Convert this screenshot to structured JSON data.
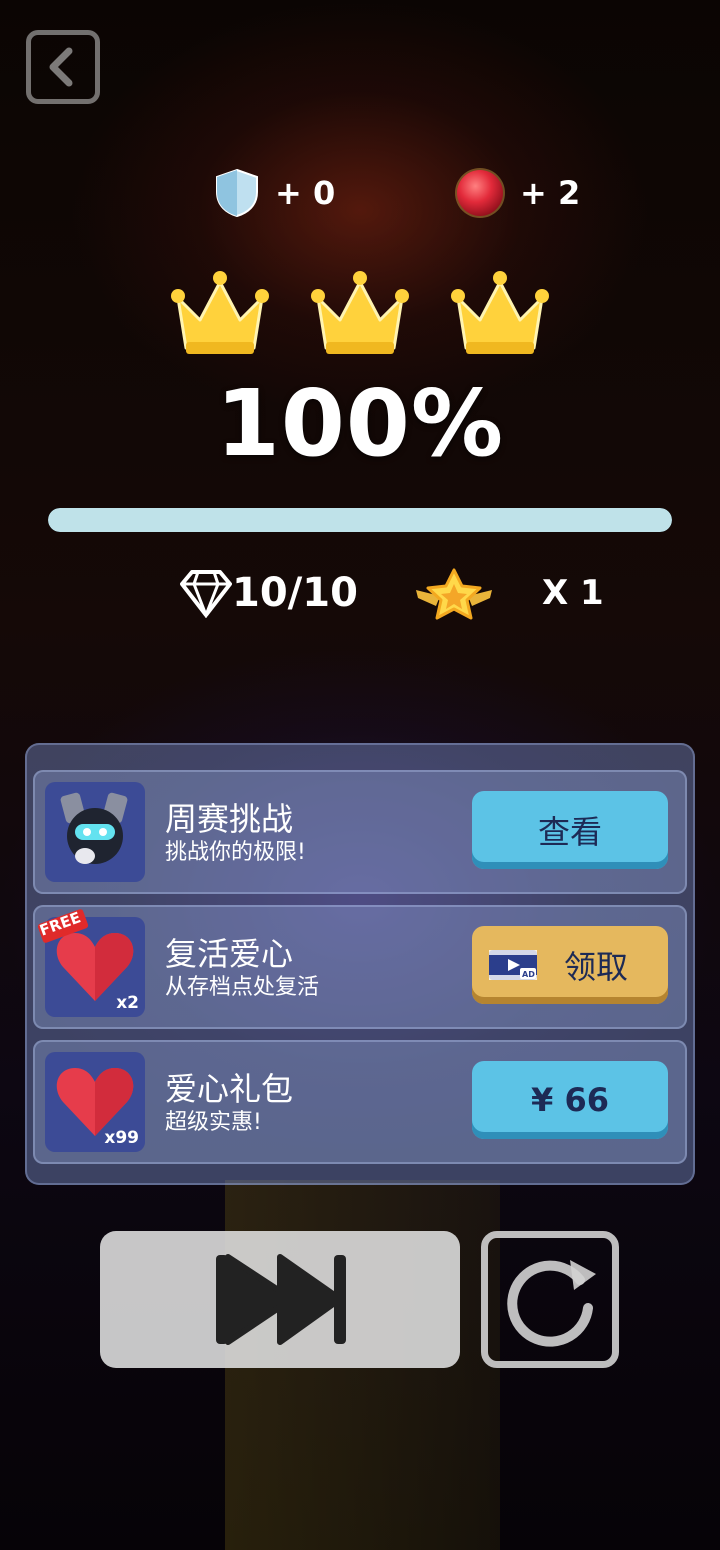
{
  "rewards": {
    "shield_bonus": "+ 0",
    "ball_bonus": "+ 2"
  },
  "crowns": {
    "earned": 3,
    "total": 3
  },
  "progress": {
    "percent_label": "100%",
    "fill_fraction": 1.0
  },
  "stats": {
    "diamonds": "10/10",
    "multiplier": "X 1"
  },
  "offers": [
    {
      "title": "周赛挑战",
      "subtitle": "挑战你的极限!",
      "button_label": "查看",
      "icon": "robot-character-icon"
    },
    {
      "title": "复活爱心",
      "subtitle": "从存档点处复活",
      "button_label": "领取",
      "badge": "FREE",
      "count": "x2",
      "icon": "heart-icon",
      "button_icon": "video-ad-icon"
    },
    {
      "title": "爱心礼包",
      "subtitle": "超级实惠!",
      "button_label": "¥ 66",
      "count": "x99",
      "icon": "heart-icon"
    }
  ],
  "controls": {
    "back": "back-arrow-icon",
    "skip": "skip-forward-icon",
    "replay": "replay-icon"
  },
  "colors": {
    "progress_fill": "#bfe2e9",
    "blue_button": "#5cc3e6",
    "yellow_button": "#e5b85e",
    "icon_tile": "#3c4b96"
  }
}
